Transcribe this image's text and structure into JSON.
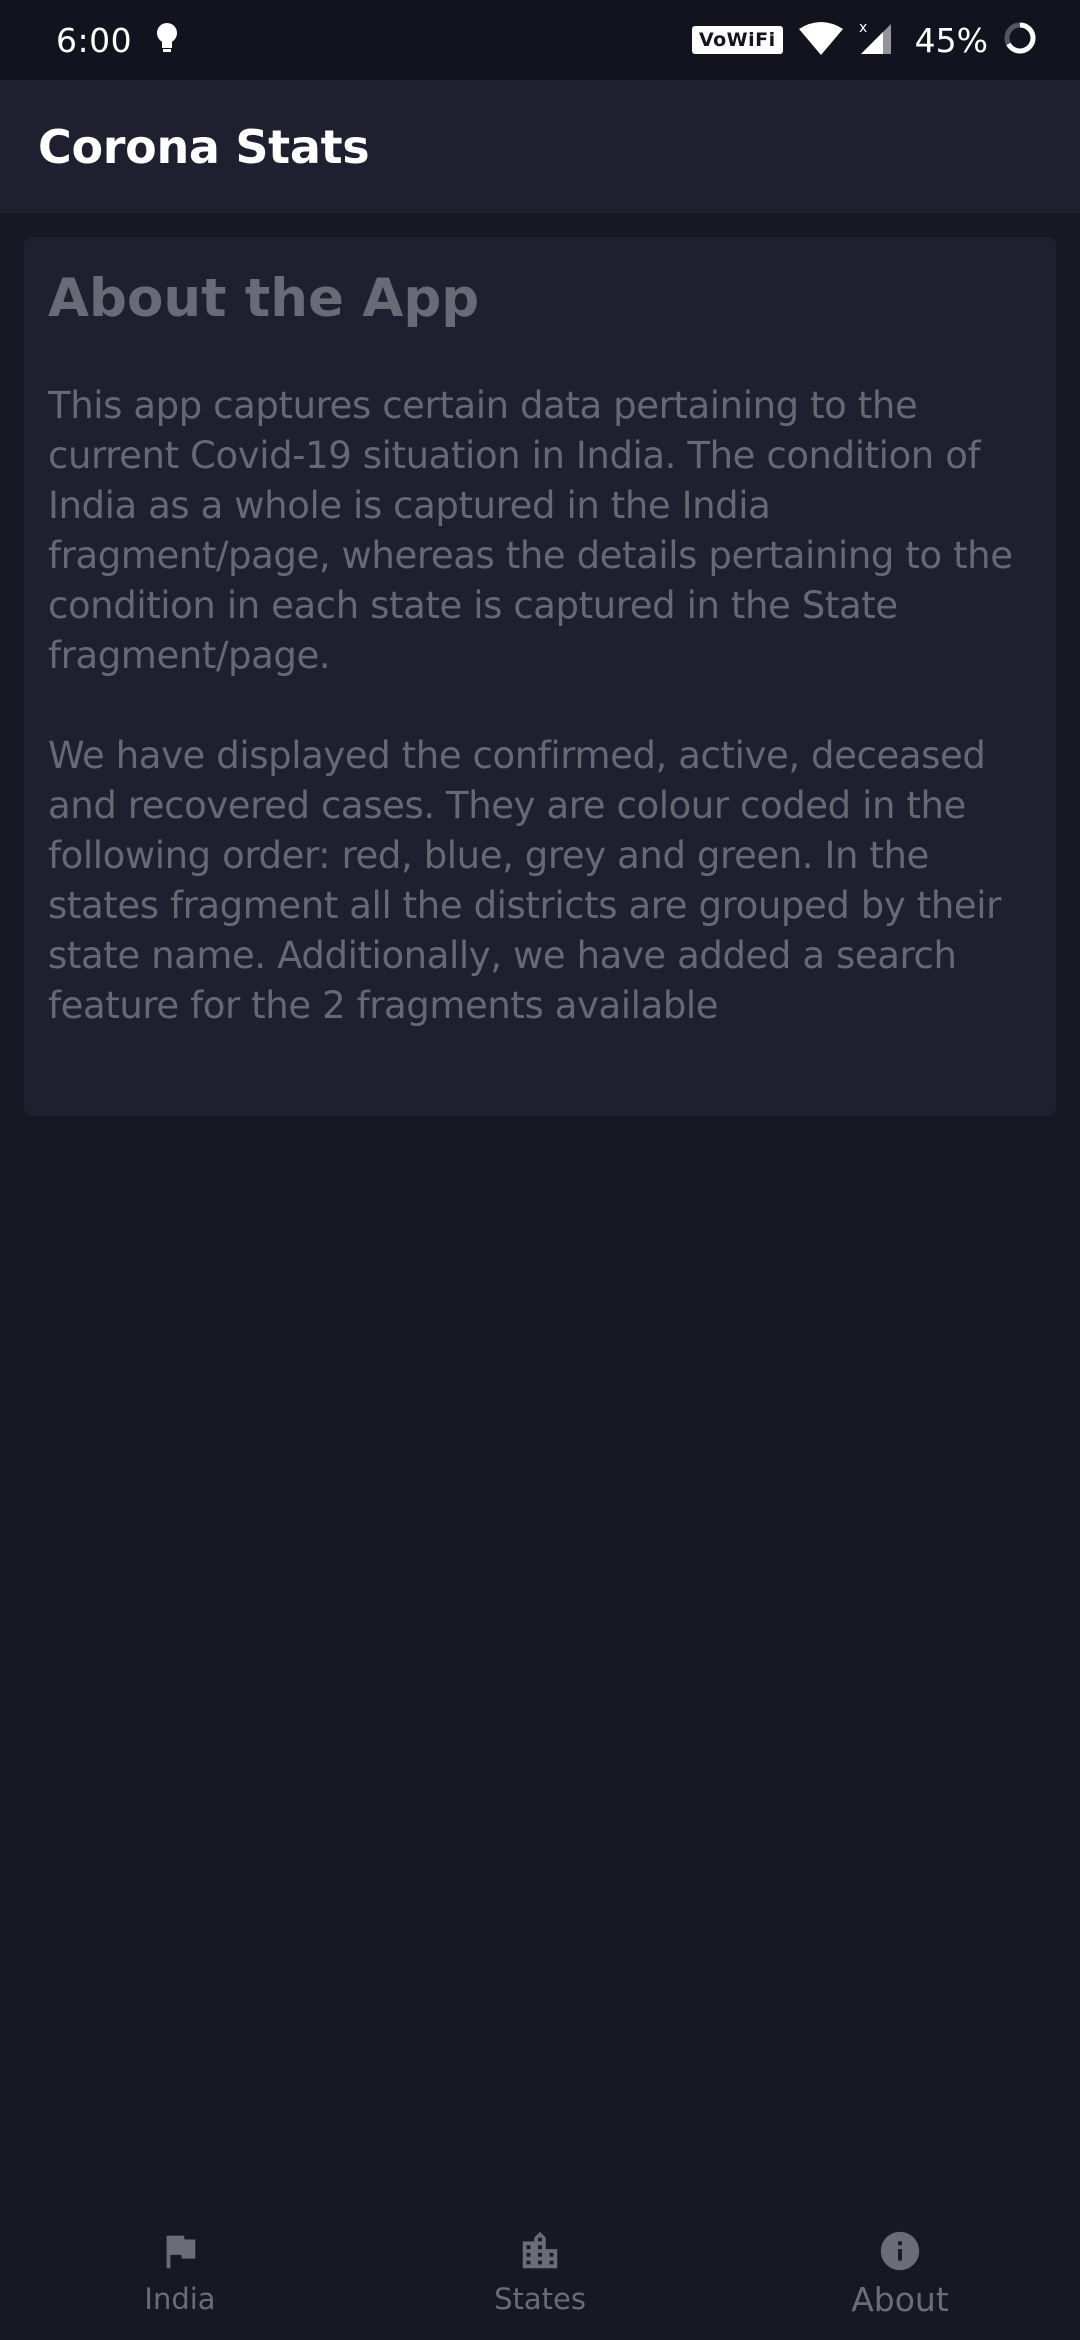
{
  "status_bar": {
    "time": "6:00",
    "vowifi": "VoWiFi",
    "battery": "45%",
    "icons": [
      "bulb-icon",
      "wifi-icon",
      "cell-signal-icon",
      "battery-ring-icon"
    ]
  },
  "app_bar": {
    "title": "Corona Stats"
  },
  "about": {
    "heading": "About the App",
    "paragraph_1": "This app captures certain data pertaining to the current Covid-19 situation in India. The condition of India as a whole is captured in the India fragment/page, whereas the details pertaining to the condition in each state is captured in the State fragment/page.",
    "paragraph_2": " We have displayed the confirmed, active, deceased and recovered cases. They are colour coded in the following order: red, blue, grey and green. In the states fragment all the districts are grouped by their state name. Additionally, we have added a search feature for the 2 fragments available"
  },
  "bottom_nav": {
    "items": [
      {
        "label": "India",
        "icon": "flag-icon"
      },
      {
        "label": "States",
        "icon": "buildings-icon"
      },
      {
        "label": "About",
        "icon": "info-icon",
        "selected": true
      }
    ]
  },
  "colors": {
    "background": "#181724",
    "surface": "#1f1f2f",
    "status_bar": "#131320",
    "text_muted": "#6b6c78",
    "title_text": "#ffffff"
  }
}
